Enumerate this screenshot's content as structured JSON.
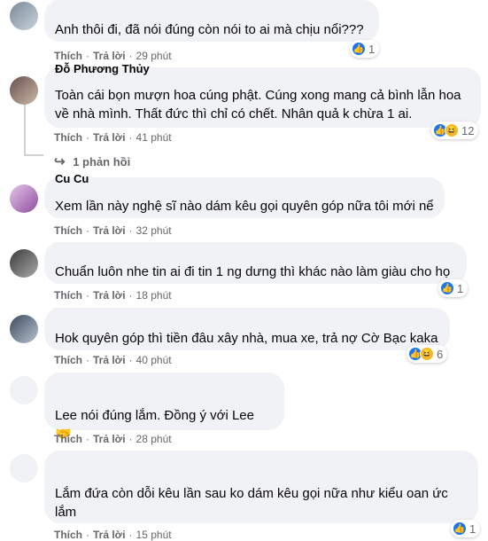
{
  "actions": {
    "like": "Thích",
    "reply": "Trả lời"
  },
  "comments": [
    {
      "text": "Anh thôi đi, đã nói đúng còn nói to ai mà chịu nổi???",
      "time": "29 phút",
      "reactions": {
        "icons": [
          "like-icon"
        ],
        "count": "1"
      }
    },
    {
      "name": "Đỗ Phương Thủy",
      "text": "Toàn cái bọn mượn hoa cúng phật. Cúng xong mang cả bình lẫn hoa về nhà mình. Thất đức thì chỉ có chết. Nhân quả k chừa 1 ai.",
      "time": "41 phút",
      "reactions": {
        "icons": [
          "like-icon",
          "haha-icon"
        ],
        "count": "12"
      },
      "replies_label": "1 phản hồi"
    },
    {
      "name": "Cu Cu",
      "text": "Xem lần này nghệ sĩ nào dám kêu gọi quyên góp nữa tôi mới nể",
      "time": "32 phút"
    },
    {
      "text": "Chuẩn luôn nhe tin ai đi tin 1 ng dưng thì khác nào làm giàu cho họ",
      "time": "18 phút",
      "reactions": {
        "icons": [
          "like-icon"
        ],
        "count": "1"
      }
    },
    {
      "text": "Hok quyên góp thì tiền đâu xây nhà, mua xe, trả nợ Cờ Bạc kaka",
      "time": "40 phút",
      "reactions": {
        "icons": [
          "like-icon",
          "haha-icon"
        ],
        "count": "6"
      }
    },
    {
      "text": "Lee nói đúng lắm. Đồng ý với Lee 🤝",
      "time": "28 phút"
    },
    {
      "text": "Lắm đứa còn dỗi kêu lần sau ko dám kêu gọi nữa như kiểu oan ức lắm",
      "time": "15 phút",
      "reactions": {
        "icons": [
          "like-icon"
        ],
        "count": "1"
      }
    }
  ],
  "colors": {
    "bubble": "#f0f2f5",
    "meta": "#65676b",
    "like": "#1877f2",
    "haha": "#f7b928"
  }
}
